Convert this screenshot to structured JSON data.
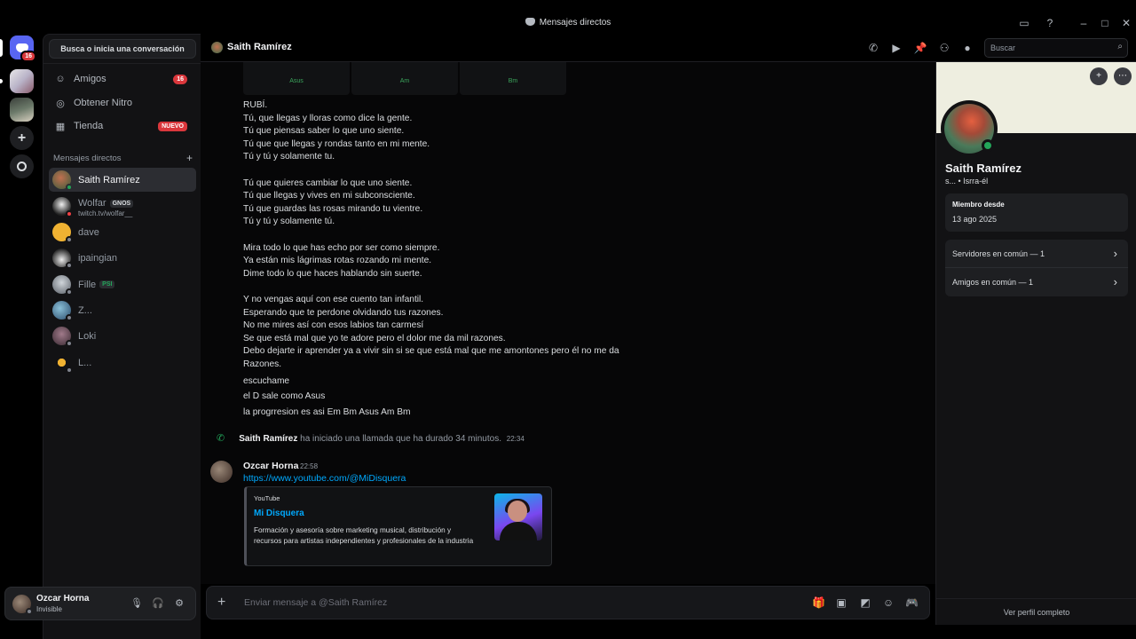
{
  "window": {
    "title": "Mensajes directos"
  },
  "rail": {
    "home_badge": "16"
  },
  "dm_sidebar": {
    "search_label": "Busca o inicia una conversación",
    "nav": [
      {
        "label": "Amigos",
        "count": "16"
      },
      {
        "label": "Obtener Nitro"
      },
      {
        "label": "Tienda",
        "badge": "NUEVO"
      }
    ],
    "section_title": "Mensajes directos",
    "dms": [
      {
        "name": "Saith Ramírez",
        "status": "online",
        "color": "#7a5a40"
      },
      {
        "name": "Wolfar",
        "tag": "GNOS",
        "sub": "twitch.tv/wolfar__",
        "status": "dnd",
        "color": "#e8e8e8"
      },
      {
        "name": "dave",
        "status": "offline",
        "color": "#f0b232"
      },
      {
        "name": "ipaingian",
        "status": "offline",
        "color": "#d8d8d8"
      },
      {
        "name": "Fille",
        "tag": "PSI",
        "status": "offline",
        "color": "#9aa3ab"
      },
      {
        "name": "Z...",
        "status": "offline",
        "color": "#4a8aa8"
      },
      {
        "name": "Loki",
        "status": "offline",
        "color": "#6a4a5a"
      },
      {
        "name": "L...",
        "status": "offline",
        "color": "#f0b232"
      }
    ]
  },
  "user_panel": {
    "name": "Ozcar Horna",
    "status": "Invisible"
  },
  "chat_header": {
    "title": "Saith Ramírez",
    "search_placeholder": "Buscar"
  },
  "chat": {
    "attachments": [
      "Asus",
      "Am",
      "Bm"
    ],
    "lyrics": [
      [
        "RUBÍ.",
        "Tú, que llegas y lloras como dice la gente.",
        "Tú que piensas saber lo que uno siente.",
        "Tú que que llegas y rondas tanto en mi mente.",
        "Tú y tú y solamente tu."
      ],
      [
        "Tú que quieres cambiar lo que uno siente.",
        "Tú que llegas y vives en mi subconsciente.",
        "Tú que guardas las rosas mirando tu vientre.",
        "Tú y tú y solamente tú."
      ],
      [
        "Mira todo lo que has echo por ser como siempre.",
        "Ya están mis lágrimas rotas rozando mi mente.",
        "Dime todo lo que haces hablando sin suerte."
      ],
      [
        "Y no vengas aquí con ese cuento tan infantil.",
        "Esperando que te perdone olvidando tus razones.",
        "No me mires así con esos labios tan carmesí",
        "Se que está mal que yo te adore pero el dolor me da mil razones.",
        "Debo dejarte ir aprender ya a vivir sin si se que está mal que me amontones pero él no me da Razones."
      ]
    ],
    "extra_lines": [
      "escuchame",
      "el D sale como Asus",
      "la progrresion es asi Em Bm Asus Am Bm"
    ],
    "call": {
      "caller": "Saith Ramírez",
      "text": "ha iniciado una llamada que ha durado 34 minutos.",
      "time": "22:34"
    },
    "message": {
      "author": "Ozcar Horna",
      "time": "22:58",
      "link": "https://www.youtube.com/@MiDisquera",
      "embed": {
        "provider": "YouTube",
        "title": "Mi Disquera",
        "description": "Formación y asesoría sobre marketing musical, distribución y recursos para artistas independientes y profesionales de la industria"
      }
    }
  },
  "composer": {
    "placeholder": "Enviar mensaje a @Saith Ramírez"
  },
  "profile": {
    "name": "Saith Ramírez",
    "subtitle": "s...  •  Isrra-él",
    "member_since_label": "Miembro desde",
    "member_since": "13 ago 2025",
    "mutual_servers": "Servidores en común — 1",
    "mutual_friends": "Amigos en común — 1",
    "view_full": "Ver perfil completo"
  },
  "colors": {
    "accent": "#5865f2",
    "online": "#23a55a",
    "danger": "#da373c",
    "link": "#00a8fc"
  }
}
